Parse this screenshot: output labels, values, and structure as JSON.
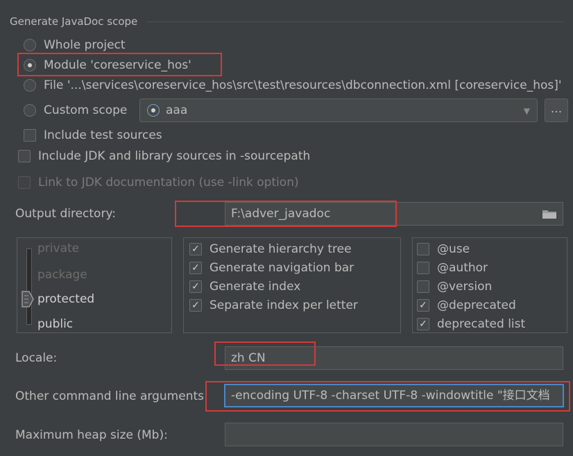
{
  "scope": {
    "title": "Generate JavaDoc scope",
    "options": {
      "whole_project": "Whole project",
      "module": "Module 'coreservice_hos'",
      "file": "File '...\\services\\coreservice_hos\\src\\test\\resources\\dbconnection.xml [coreservice_hos]'",
      "custom_scope": "Custom scope"
    },
    "selected": "module",
    "custom_scope_value": "aaa",
    "more_button": "..."
  },
  "checks": {
    "include_test_sources": {
      "label": "Include test sources",
      "checked": false
    },
    "include_jdk": {
      "label": "Include JDK and library sources in -sourcepath",
      "checked": false
    },
    "link_jdk": {
      "label": "Link to JDK documentation (use -link option)",
      "checked": false,
      "enabled": false
    }
  },
  "output": {
    "label": "Output directory:",
    "value": "F:\\adver_javadoc"
  },
  "visibility": {
    "levels": [
      "private",
      "package",
      "protected",
      "public"
    ],
    "selected": "protected"
  },
  "generate": [
    {
      "label": "Generate hierarchy tree",
      "checked": true
    },
    {
      "label": "Generate navigation bar",
      "checked": true
    },
    {
      "label": "Generate index",
      "checked": true
    },
    {
      "label": "Separate index per letter",
      "checked": true
    }
  ],
  "tags": [
    {
      "label": "@use",
      "checked": false
    },
    {
      "label": "@author",
      "checked": false
    },
    {
      "label": "@version",
      "checked": false
    },
    {
      "label": "@deprecated",
      "checked": true
    },
    {
      "label": "deprecated list",
      "checked": true
    }
  ],
  "locale": {
    "label": "Locale:",
    "value": "zh CN"
  },
  "other_args": {
    "label": "Other command line arguments:",
    "value": "-encoding UTF-8 -charset UTF-8 -windowtitle \"接口文档"
  },
  "heap": {
    "label": "Maximum heap size (Mb):",
    "value": ""
  },
  "colors": {
    "background": "#3c3f41",
    "highlight": "#d23a3a",
    "focus": "#4a88c7"
  }
}
